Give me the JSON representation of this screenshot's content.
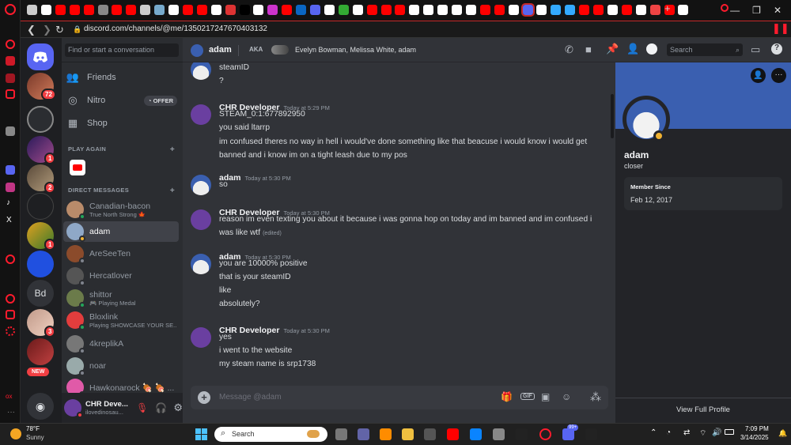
{
  "browser": {
    "url": "discord.com/channels/@me/1350217247670403132"
  },
  "dm_sidebar": {
    "search_placeholder": "Find or start a conversation",
    "nav": [
      {
        "label": "Friends"
      },
      {
        "label": "Nitro",
        "badge": "OFFER"
      },
      {
        "label": "Shop"
      }
    ],
    "play_again_header": "PLAY AGAIN",
    "direct_messages_header": "DIRECT MESSAGES",
    "dms": [
      {
        "name": "Canadian-bacon",
        "sub": "True North Strong 🍁",
        "color": "#b98b6a",
        "status": "#23a55a"
      },
      {
        "name": "adam",
        "sub": "",
        "color": "#8fa8c7",
        "status": "#f0b232",
        "active": true
      },
      {
        "name": "AreSeeTen",
        "sub": "",
        "color": "#8b4b2b",
        "status": "#80848e"
      },
      {
        "name": "Hercatlover",
        "sub": "",
        "color": "#555",
        "status": "#80848e"
      },
      {
        "name": "shittor",
        "sub": "🎮 Playing Medal",
        "color": "#6b7b4a",
        "status": "#23a55a"
      },
      {
        "name": "Bloxlink",
        "sub": "Playing SHOWCASE YOUR SE...",
        "color": "#e23d3d",
        "status": "#23a55a"
      },
      {
        "name": "4kreplikA",
        "sub": "",
        "color": "#777",
        "status": "#80848e"
      },
      {
        "name": "noar",
        "sub": "",
        "color": "#9aa",
        "status": "#80848e"
      },
      {
        "name": "Hawkonarock 🍖 🍖 ...",
        "sub": "",
        "color": "#e05aa8",
        "status": "#23a55a"
      }
    ],
    "user": {
      "name": "CHR Deve...",
      "status": "ilovedinosau..."
    }
  },
  "servers": {
    "badges": [
      "72",
      "1",
      "2",
      "1",
      "3"
    ],
    "bd_label": "Bd",
    "new_label": "NEW"
  },
  "chat_header": {
    "name": "adam",
    "aka_label": "AKA",
    "aka": "Evelyn Bowman, Melissa White, adam",
    "search_placeholder": "Search"
  },
  "messages": [
    {
      "author": "adam",
      "time": "",
      "lines": [
        "steamID",
        "?"
      ],
      "continued": true
    },
    {
      "author": "CHR Developer",
      "time": "Today at 5:29 PM",
      "lines": [
        "STEAM_0:1:677892950",
        "you said ltarrp",
        "im confused theres no way in hell i would've done something like that beacuse i would know i would get",
        "banned and i know im on a tight leash due to my pos"
      ]
    },
    {
      "author": "adam",
      "time": "Today at 5:30 PM",
      "lines": [
        "so"
      ]
    },
    {
      "author": "CHR Developer",
      "time": "Today at 5:30 PM",
      "lines": [
        "reason im even texting you about it because i was gonna hop on today and im banned and im confused i",
        "was like wtf"
      ],
      "edited": "(edited)"
    },
    {
      "author": "adam",
      "time": "Today at 5:30 PM",
      "lines": [
        "you are 10000% positive",
        "that is your steamID",
        "like",
        "absolutely?"
      ]
    },
    {
      "author": "CHR Developer",
      "time": "Today at 5:30 PM",
      "lines": [
        "yes",
        "i went to the website",
        "my steam name is srp1738"
      ]
    }
  ],
  "composer": {
    "placeholder": "Message @adam",
    "gif_label": "GIF"
  },
  "profile": {
    "name": "adam",
    "tag": "closer",
    "member_since_label": "Member Since",
    "member_since": "Feb 12, 2017",
    "view_full": "View Full Profile"
  },
  "taskbar": {
    "temp": "78°F",
    "weather": "Sunny",
    "search": "Search",
    "time": "7:09 PM",
    "date": "3/14/2025",
    "chat_badge": "99+"
  },
  "colors": {
    "blurple": "#5865f2",
    "opera_red": "#ff1b2d",
    "dev_avatar": "#6a3fa0",
    "adam_avatar": "#3a5fb0"
  }
}
